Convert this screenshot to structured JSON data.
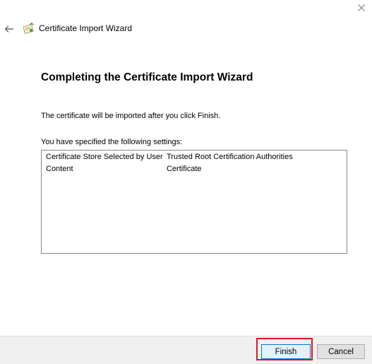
{
  "window": {
    "close_icon": "close-icon",
    "back_icon": "back-arrow-icon",
    "wizard_icon": "certificate-icon",
    "title": "Certificate Import Wizard"
  },
  "page": {
    "heading": "Completing the Certificate Import Wizard",
    "info": "The certificate will be imported after you click Finish.",
    "settings_label": "You have specified the following settings:",
    "settings": [
      {
        "key": "Certificate Store Selected by User",
        "value": "Trusted Root Certification Authorities"
      },
      {
        "key": "Content",
        "value": "Certificate"
      }
    ]
  },
  "footer": {
    "finish_label": "Finish",
    "cancel_label": "Cancel"
  },
  "colors": {
    "highlight": "#e8141c",
    "focus_border": "#0078d7"
  }
}
